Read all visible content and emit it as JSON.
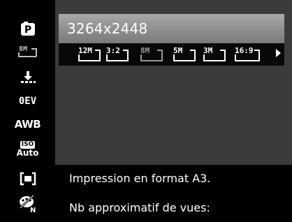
{
  "title_bar": {
    "value": "3264x2448"
  },
  "sidebar": {
    "items": [
      {
        "name": "mode-p-icon"
      },
      {
        "label": "8M"
      },
      {
        "name": "quality-icon"
      },
      {
        "label": "0EV"
      },
      {
        "label": "AWB"
      },
      {
        "label_top": "ISO",
        "label_bottom": "Auto"
      },
      {
        "name": "metering-icon"
      },
      {
        "name": "color-mode-icon"
      }
    ]
  },
  "size_options": [
    {
      "label": "12M",
      "state": "normal"
    },
    {
      "label": "3:2",
      "state": "normal"
    },
    {
      "label": "8M",
      "state": "selected"
    },
    {
      "label": "5M",
      "state": "normal"
    },
    {
      "label": "3M",
      "state": "normal"
    },
    {
      "label": "16:9",
      "state": "normal"
    }
  ],
  "info": {
    "line1": "Impression en format A3.",
    "line2": "Nb approximatif de vues:"
  }
}
